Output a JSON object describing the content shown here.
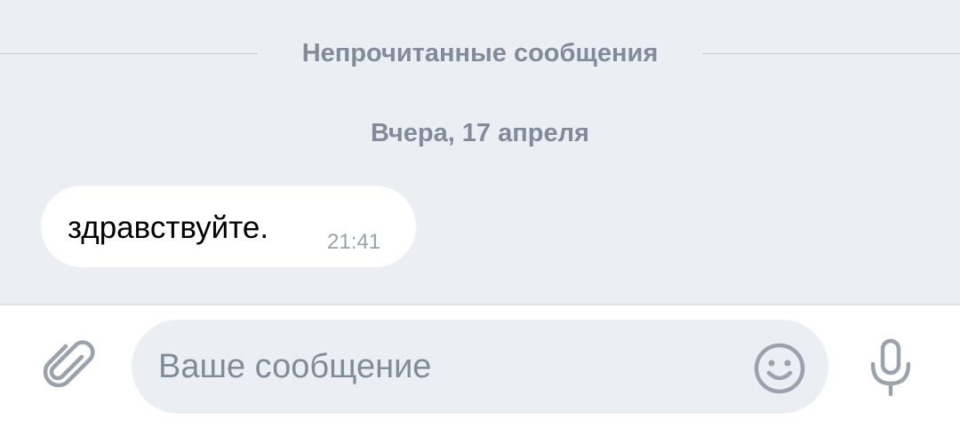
{
  "chat": {
    "unread_divider": "Непрочитанные сообщения",
    "date_label": "Вчера, 17 апреля",
    "messages": [
      {
        "text": "здравствуйте.",
        "time": "21:41"
      }
    ]
  },
  "composer": {
    "placeholder": "Ваше сообщение",
    "icons": {
      "attach": "paperclip-icon",
      "emoji": "smiley-icon",
      "mic": "microphone-icon"
    }
  },
  "colors": {
    "background": "#ebeef3",
    "bubble": "#ffffff",
    "muted_text": "#828b99",
    "icon": "#99a2ad"
  }
}
